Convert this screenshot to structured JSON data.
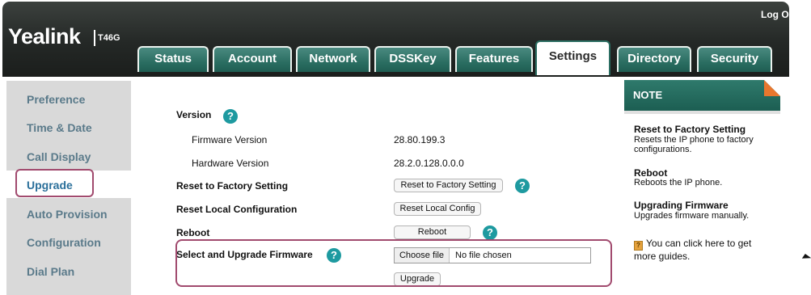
{
  "header": {
    "logo": "Yealink",
    "model": "T46G",
    "logout_label": "Log Out"
  },
  "tabs": [
    {
      "label": "Status"
    },
    {
      "label": "Account"
    },
    {
      "label": "Network"
    },
    {
      "label": "DSSKey"
    },
    {
      "label": "Features"
    },
    {
      "label": "Settings",
      "active": true
    },
    {
      "label": "Directory"
    },
    {
      "label": "Security"
    }
  ],
  "sidebar": {
    "items": [
      {
        "label": "Preference"
      },
      {
        "label": "Time & Date"
      },
      {
        "label": "Call Display"
      },
      {
        "label": "Upgrade",
        "active": true
      },
      {
        "label": "Auto Provision"
      },
      {
        "label": "Configuration"
      },
      {
        "label": "Dial Plan"
      }
    ]
  },
  "main": {
    "version_label": "Version",
    "firmware_version_label": "Firmware Version",
    "firmware_version_value": "28.80.199.3",
    "hardware_version_label": "Hardware Version",
    "hardware_version_value": "28.2.0.128.0.0.0",
    "reset_factory_label": "Reset to Factory Setting",
    "reset_factory_button": "Reset to Factory Setting",
    "reset_local_label": "Reset Local Configuration",
    "reset_local_button": "Reset Local Config",
    "reboot_label": "Reboot",
    "reboot_button": "Reboot",
    "upgrade_firmware_label": "Select and Upgrade Firmware",
    "choose_file_button": "Choose file",
    "no_file_text": "No file chosen",
    "upgrade_button": "Upgrade",
    "help_glyph": "?"
  },
  "note": {
    "title": "NOTE",
    "items": [
      {
        "heading": "Reset to Factory Setting",
        "text": "Resets the IP phone to factory configurations."
      },
      {
        "heading": "Reboot",
        "text": "Reboots the IP phone."
      },
      {
        "heading": "Upgrading Firmware",
        "text": "Upgrades firmware manually."
      }
    ],
    "guide_text": "You can click here to get more guides.",
    "guide_icon": "book-icon"
  },
  "colors": {
    "header_bg": "#242826",
    "tab_green": "#2b6e62",
    "help_teal": "#1e9aa0",
    "highlight_box": "#a14a6e",
    "note_fold": "#e8772e"
  }
}
